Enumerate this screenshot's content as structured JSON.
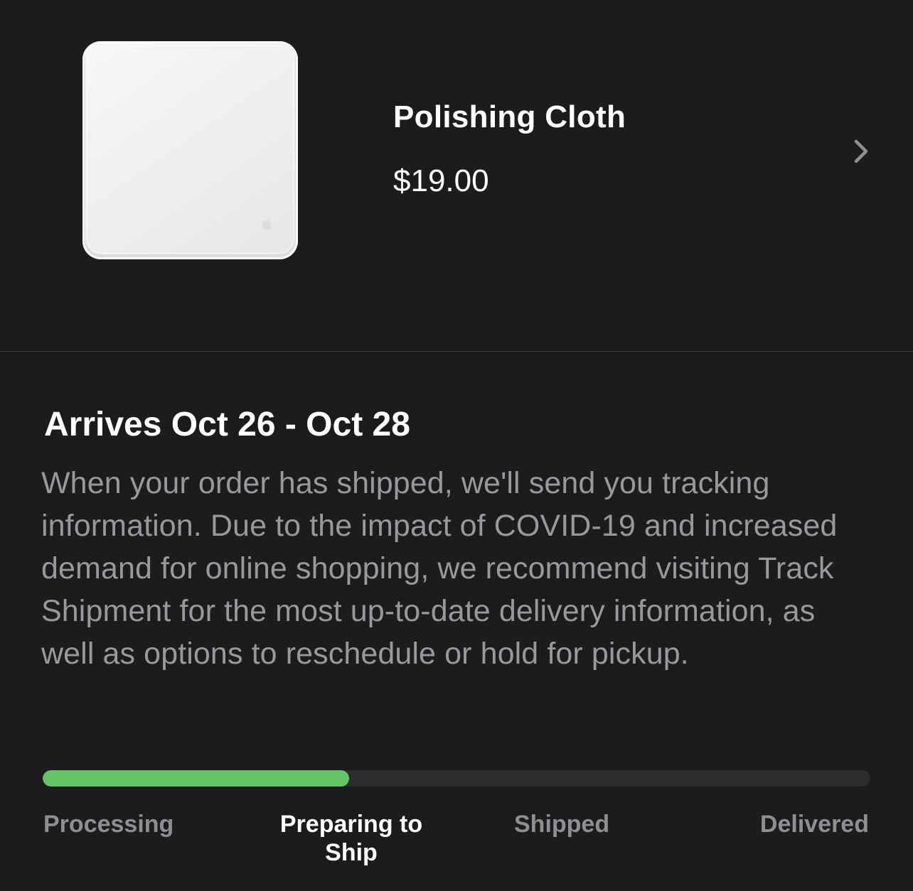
{
  "product": {
    "name": "Polishing Cloth",
    "price": "$19.00",
    "image_icon": "polishing-cloth-image",
    "chevron_icon": "chevron-right-icon"
  },
  "delivery": {
    "title": "Arrives Oct 26 - Oct 28",
    "description": "When your order has shipped, we'll send you tracking information. Due to the impact of COVID-19 and increased demand for online shopping, we recommend visiting Track Shipment for the most up-to-date delivery information, as well as options to reschedule or hold for pickup."
  },
  "progress": {
    "fraction_complete": 0.37,
    "fill_color": "#65c466",
    "track_color": "#2c2c2e",
    "current_step_index": 1,
    "steps": [
      {
        "label": "Processing"
      },
      {
        "label": "Preparing to Ship"
      },
      {
        "label": "Shipped"
      },
      {
        "label": "Delivered"
      }
    ]
  },
  "colors": {
    "background": "#1c1c1e",
    "primary_text": "#ffffff",
    "secondary_text": "#98989d",
    "divider": "#3a3a3c"
  }
}
